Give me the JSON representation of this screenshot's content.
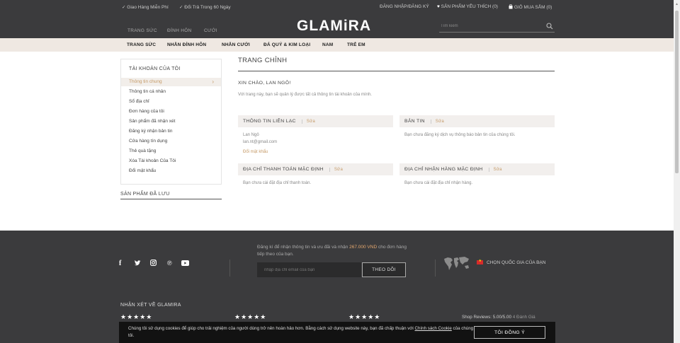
{
  "topbar": {
    "free_shipping": "Giao Hàng Miễn Phí",
    "returns": "Đổi Trả Trong 60 Ngày",
    "login": "ĐĂNG NHẬP/ĐĂNG KÝ",
    "wishlist": "SẢN PHẨM YÊU THÍCH (0)",
    "cart": "GIỎ MUA SẮM (0)"
  },
  "header": {
    "logo": "GLAMiRA",
    "nav": [
      "TRANG SỨC",
      "ĐÍNH HÔN",
      "CƯỚI"
    ],
    "search_placeholder": "Tìm kiếm"
  },
  "main_nav": [
    "TRANG SỨC",
    "NHẪN ĐÍNH HÔN",
    "NHẪN CƯỚI",
    "ĐÁ QUÝ & KIM LOẠI",
    "NAM",
    "TRẺ EM"
  ],
  "sidebar": {
    "title": "TÀI KHOẢN CỦA TÔI",
    "items": [
      {
        "label": "Thông tin chung",
        "active": true
      },
      {
        "label": "Thông tin cá nhân"
      },
      {
        "label": "Sổ địa chỉ"
      },
      {
        "label": "Đơn hàng của tôi"
      },
      {
        "label": "Sản phẩm đã nhận xét"
      },
      {
        "label": "Đăng ký nhận bản tin"
      },
      {
        "label": "Cửa hàng tín dụng"
      },
      {
        "label": "Thẻ quà tặng"
      },
      {
        "label": "Xóa Tài khoản Của Tôi"
      },
      {
        "label": "Đổi mật khẩu"
      }
    ],
    "saved_title": "SẢN PHẨM ĐÃ LƯU"
  },
  "main": {
    "title": "TRANG CHỈNH",
    "greeting": "XIN CHÀO, LAN NGÔ!",
    "intro": "Với trang này, bạn sẽ quản lý được tất cả thông tin tài khoản của mình.",
    "edit_label": "Sửa",
    "contact": {
      "title": "THÔNG TIN LIÊN LẠC",
      "name": "Lan Ngô",
      "email": "lan.nt@gmail.com",
      "change_password": "Đổi mật khẩu"
    },
    "newsletter": {
      "title": "BẢN TIN",
      "text": "Bạn chưa đăng ký dịch vụ thông báo bản tin của chúng tôi."
    },
    "billing": {
      "title": "ĐỊA CHỈ THANH TOÁN MẶC ĐỊNH",
      "text": "Bạn chưa cài đặt địa chỉ thanh toán."
    },
    "shipping": {
      "title": "ĐỊA CHỈ NHẬN HÀNG MẶC ĐỊNH",
      "text": "Bạn chưa cài đặt địa chỉ nhận hàng."
    }
  },
  "footer": {
    "newsletter_pre": "Đăng kí để nhận thông tin và ưu đãi và nhận ",
    "newsletter_amount": "267.000 VND",
    "newsletter_post": " cho đơn hàng tiếp theo của bạn.",
    "email_placeholder": "nhập địa chỉ email của bạn",
    "follow_button": "THEO DÕI",
    "country": "CHỌN QUỐC GIA CỦA BẠN",
    "reviews_title": "NHẬN XÉT VỀ GLAMIRA",
    "shop_reviews": "Shop Reviews: 5.00/5.00",
    "shop_reviews_count": "4 Đánh Giá",
    "stars": "★★★★★"
  },
  "cookie": {
    "text": "Chúng tôi sử dụng cookies để giúp cho trải nghiệm của người dùng trở nên hoàn hảo hơn. Bằng cách sử dụng website này, bạn đã chấp thuận với ",
    "link": "Chính sách Cookie",
    "text_end": " của chúng tôi.",
    "button": "TÔI ĐỒNG Ý"
  },
  "colors": {
    "dark": "#3b3b3d",
    "accent": "#c59a67",
    "nav_bg": "#efe8e2",
    "highlight": "#e6a86f"
  }
}
